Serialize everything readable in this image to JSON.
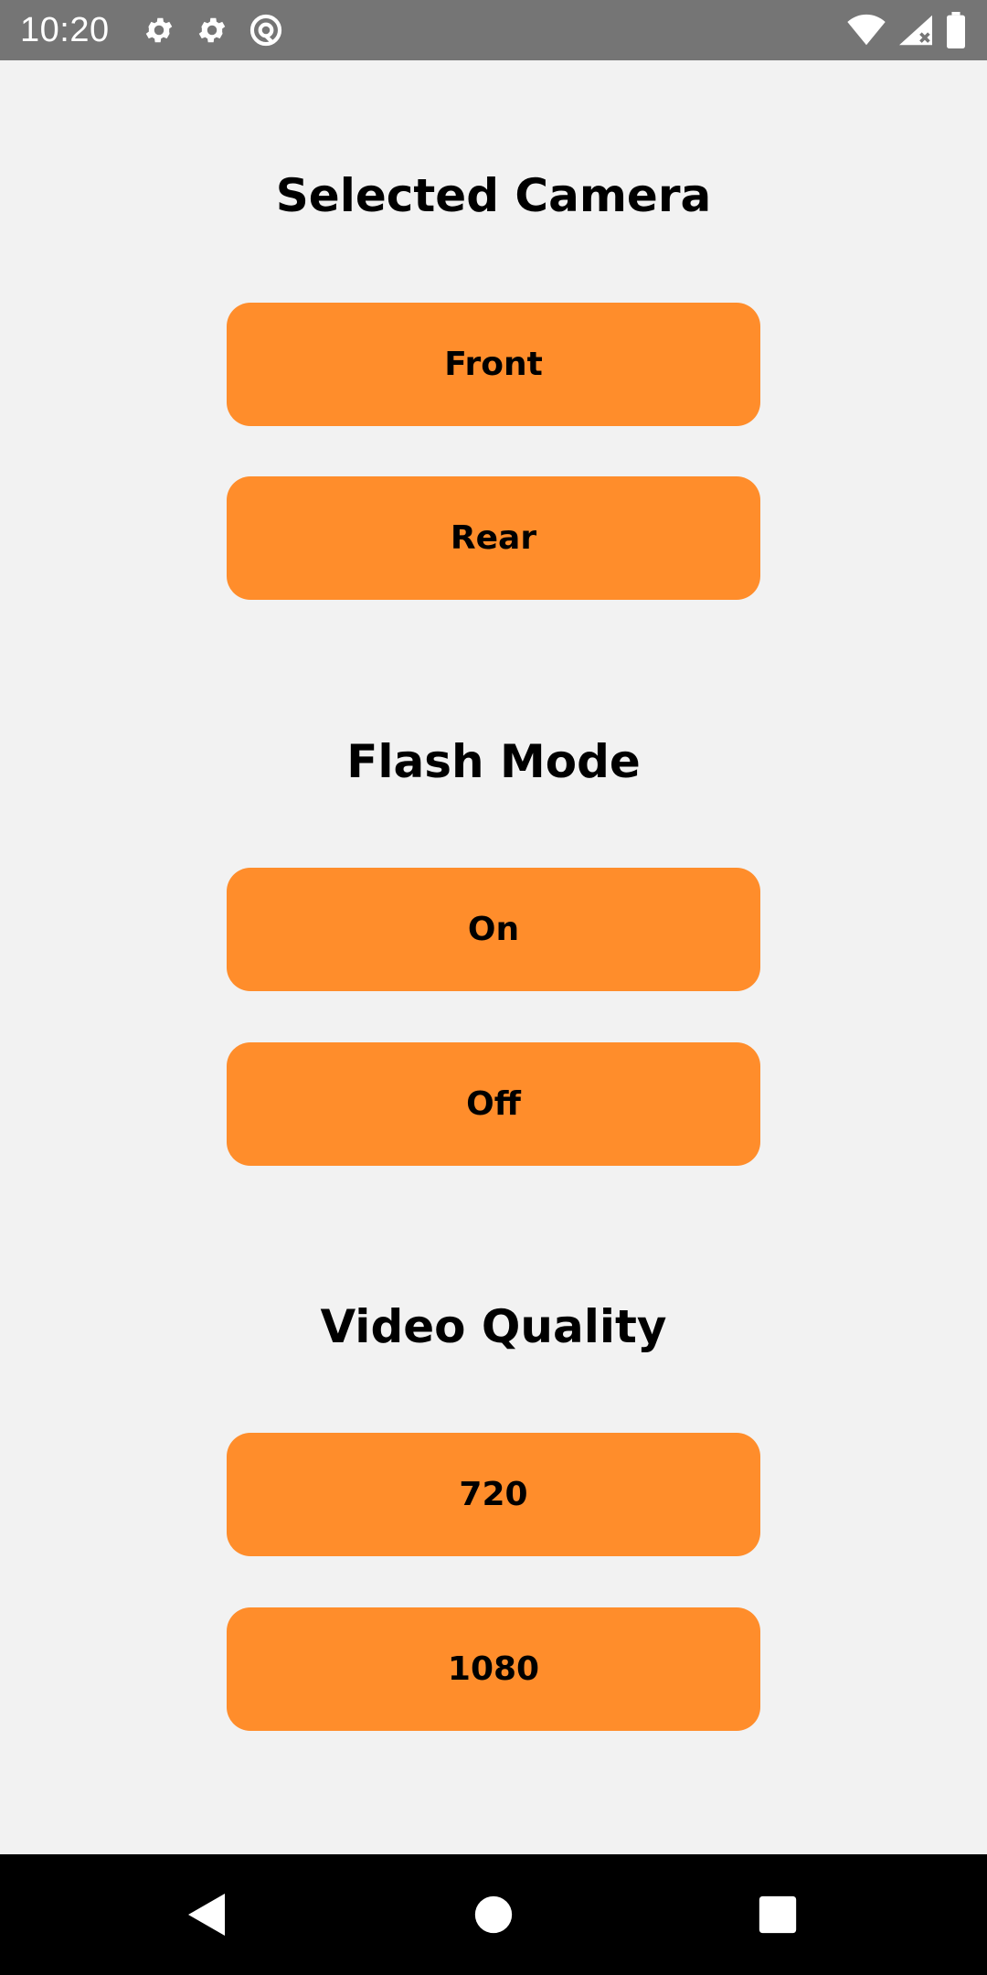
{
  "status_bar": {
    "time": "10:20",
    "left_icons": [
      "gear-icon",
      "gear-icon",
      "at-sign-icon"
    ],
    "right_icons": [
      "wifi-icon",
      "cell-signal-icon",
      "battery-icon"
    ]
  },
  "sections": [
    {
      "title": "Selected Camera",
      "options": [
        "Front",
        "Rear"
      ]
    },
    {
      "title": "Flash Mode",
      "options": [
        "On",
        "Off"
      ]
    },
    {
      "title": "Video Quality",
      "options": [
        "720",
        "1080"
      ]
    }
  ],
  "colors": {
    "button": "#ff8d2b",
    "background": "#f2f2f2",
    "status_bar": "#757575",
    "nav_bar": "#000000"
  },
  "nav_bar": {
    "icons": [
      "back-icon",
      "home-icon",
      "recents-icon"
    ]
  }
}
